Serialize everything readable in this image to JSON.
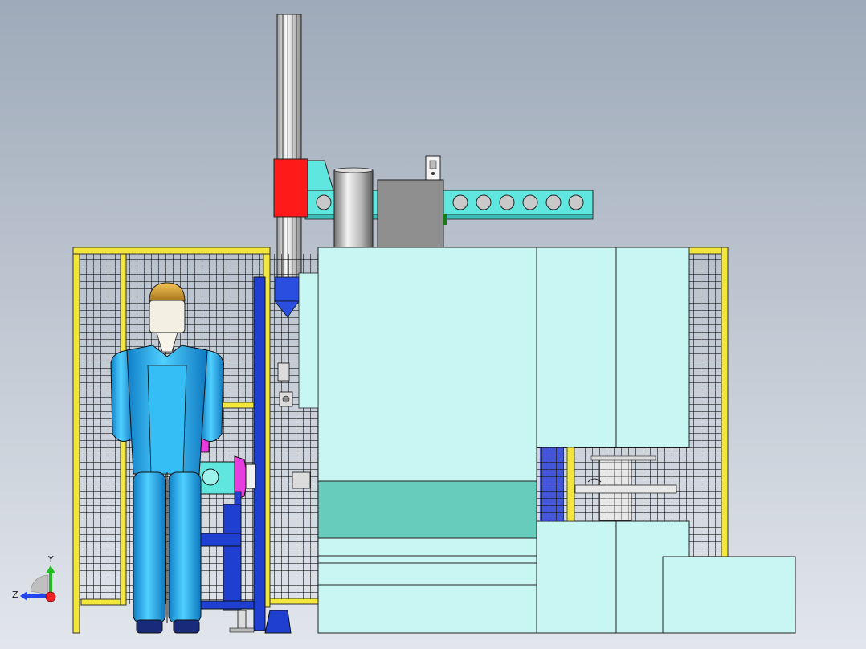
{
  "view": {
    "background_top": "#9eaab9",
    "background_bottom": "#e2e6ec"
  },
  "colors": {
    "cabinet": "#c8f7f3",
    "cabinet_band": "#66ccbb",
    "fence_yellow": "#f2e73a",
    "mesh": "#1c1c1c",
    "column_steel": "#e4e4e4",
    "carriage_red": "#ff1a1a",
    "beam_cyan": "#5fe6df",
    "motor_gray": "#8f8f8f",
    "drum_gray": "#c4c4c4",
    "frame_blue": "#1e3fd0",
    "operator_suit": "#22aaee",
    "helmet_gold": "#d7a23a",
    "magenta_part": "#e63ce0"
  },
  "triad": {
    "y_label": "Y",
    "z_label": "Z",
    "y_color": "#22bb22",
    "z_color": "#2244ee",
    "origin_color": "#ee2222"
  },
  "icons": {
    "view_triad": "axis-triad-icon"
  }
}
